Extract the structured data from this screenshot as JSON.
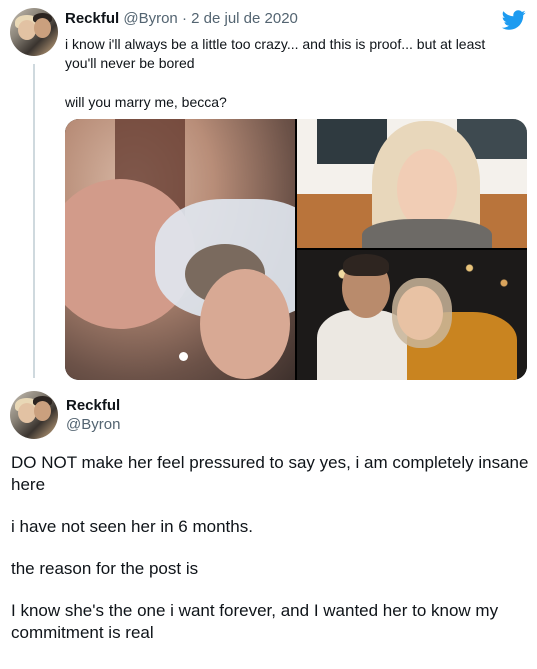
{
  "tweet1": {
    "author_name": "Reckful",
    "handle": "@Byron",
    "separator": "·",
    "date": "2 de jul de 2020",
    "text_line1": "i know i'll always be a little too crazy... and this is proof... but at least you'll never be bored",
    "text_line2": "will you marry me, becca?",
    "media": [
      "photo-left",
      "photo-top-right",
      "photo-bottom-right"
    ]
  },
  "tweet2": {
    "author_name": "Reckful",
    "handle": "@Byron",
    "paragraphs": [
      "DO NOT make her feel pressured to say yes, i am completely insane here",
      "i have not seen her in 6 months.",
      "the reason for the post is",
      "I know she's the one i want forever, and I wanted her to know my commitment is real"
    ]
  },
  "colors": {
    "twitter_blue": "#1d9bf0",
    "text": "#0f1419",
    "muted": "#536471",
    "thread_line": "#cfd9de"
  },
  "icons": {
    "logo": "twitter-bird-icon"
  }
}
